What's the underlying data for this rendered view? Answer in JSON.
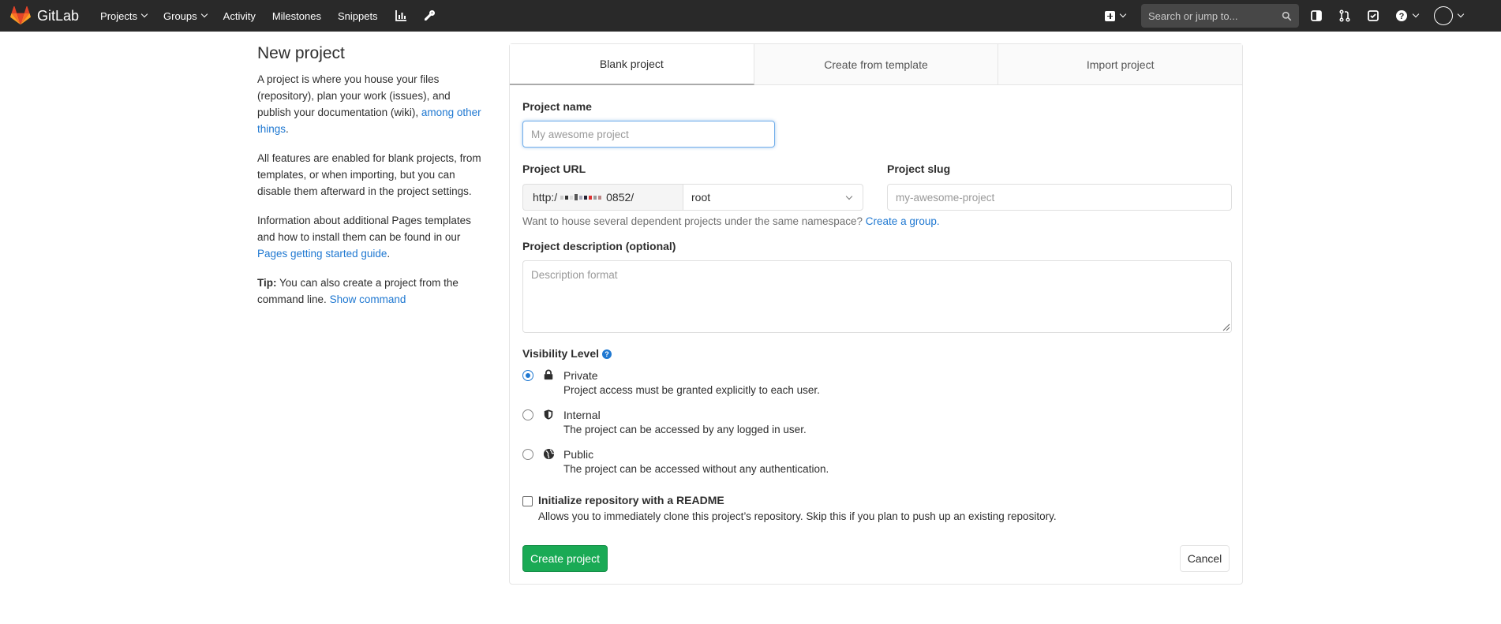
{
  "navbar": {
    "brand": "GitLab",
    "links": [
      {
        "label": "Projects",
        "has_dropdown": true
      },
      {
        "label": "Groups",
        "has_dropdown": true
      },
      {
        "label": "Activity",
        "has_dropdown": false
      },
      {
        "label": "Milestones",
        "has_dropdown": false
      },
      {
        "label": "Snippets",
        "has_dropdown": false
      }
    ],
    "icons": [
      "chart-icon",
      "wrench-icon"
    ],
    "search_placeholder": "Search or jump to...",
    "right_icons": [
      "sidebar-toggle-icon",
      "merge-request-icon",
      "todo-check-icon",
      "help-icon"
    ],
    "colors": {
      "background": "#292929",
      "brand_orange": "#e24329"
    }
  },
  "sidebar": {
    "title": "New project",
    "para1_text": "A project is where you house your files (repository), plan your work (issues), and publish your documentation (wiki),",
    "para1_link": "among other things",
    "para1_end": ".",
    "para2": "All features are enabled for blank projects, from templates, or when importing, but you can disable them afterward in the project settings.",
    "para3_text": "Information about additional Pages templates and how to install them can be found in our",
    "para3_link": "Pages getting started guide",
    "para3_end": ".",
    "tip_label": "Tip:",
    "tip_text": "You can also create a project from the command line.",
    "tip_link": "Show command"
  },
  "tabs": [
    {
      "label": "Blank project",
      "active": true
    },
    {
      "label": "Create from template",
      "active": false
    },
    {
      "label": "Import project",
      "active": false
    }
  ],
  "form": {
    "project_name_label": "Project name",
    "project_name_placeholder": "My awesome project",
    "project_name_value": "",
    "project_url_label": "Project URL",
    "project_url_prefix_start": "http:/",
    "project_url_prefix_end": "0852/",
    "namespace_value": "root",
    "project_slug_label": "Project slug",
    "project_slug_placeholder": "my-awesome-project",
    "namespace_help": "Want to house several dependent projects under the same namespace?",
    "namespace_help_link": "Create a group.",
    "description_label": "Project description (optional)",
    "description_placeholder": "Description format",
    "visibility_label": "Visibility Level",
    "visibility_options": [
      {
        "title": "Private",
        "desc": "Project access must be granted explicitly to each user.",
        "icon": "lock-icon",
        "checked": true
      },
      {
        "title": "Internal",
        "desc": "The project can be accessed by any logged in user.",
        "icon": "shield-icon",
        "checked": false
      },
      {
        "title": "Public",
        "desc": "The project can be accessed without any authentication.",
        "icon": "globe-icon",
        "checked": false
      }
    ],
    "readme_label": "Initialize repository with a README",
    "readme_checked": false,
    "readme_help": "Allows you to immediately clone this project’s repository. Skip this if you plan to push up an existing repository.",
    "create_button": "Create project",
    "cancel_button": "Cancel",
    "colors": {
      "link": "#1f78d1",
      "create_button": "#1aaa55"
    }
  }
}
